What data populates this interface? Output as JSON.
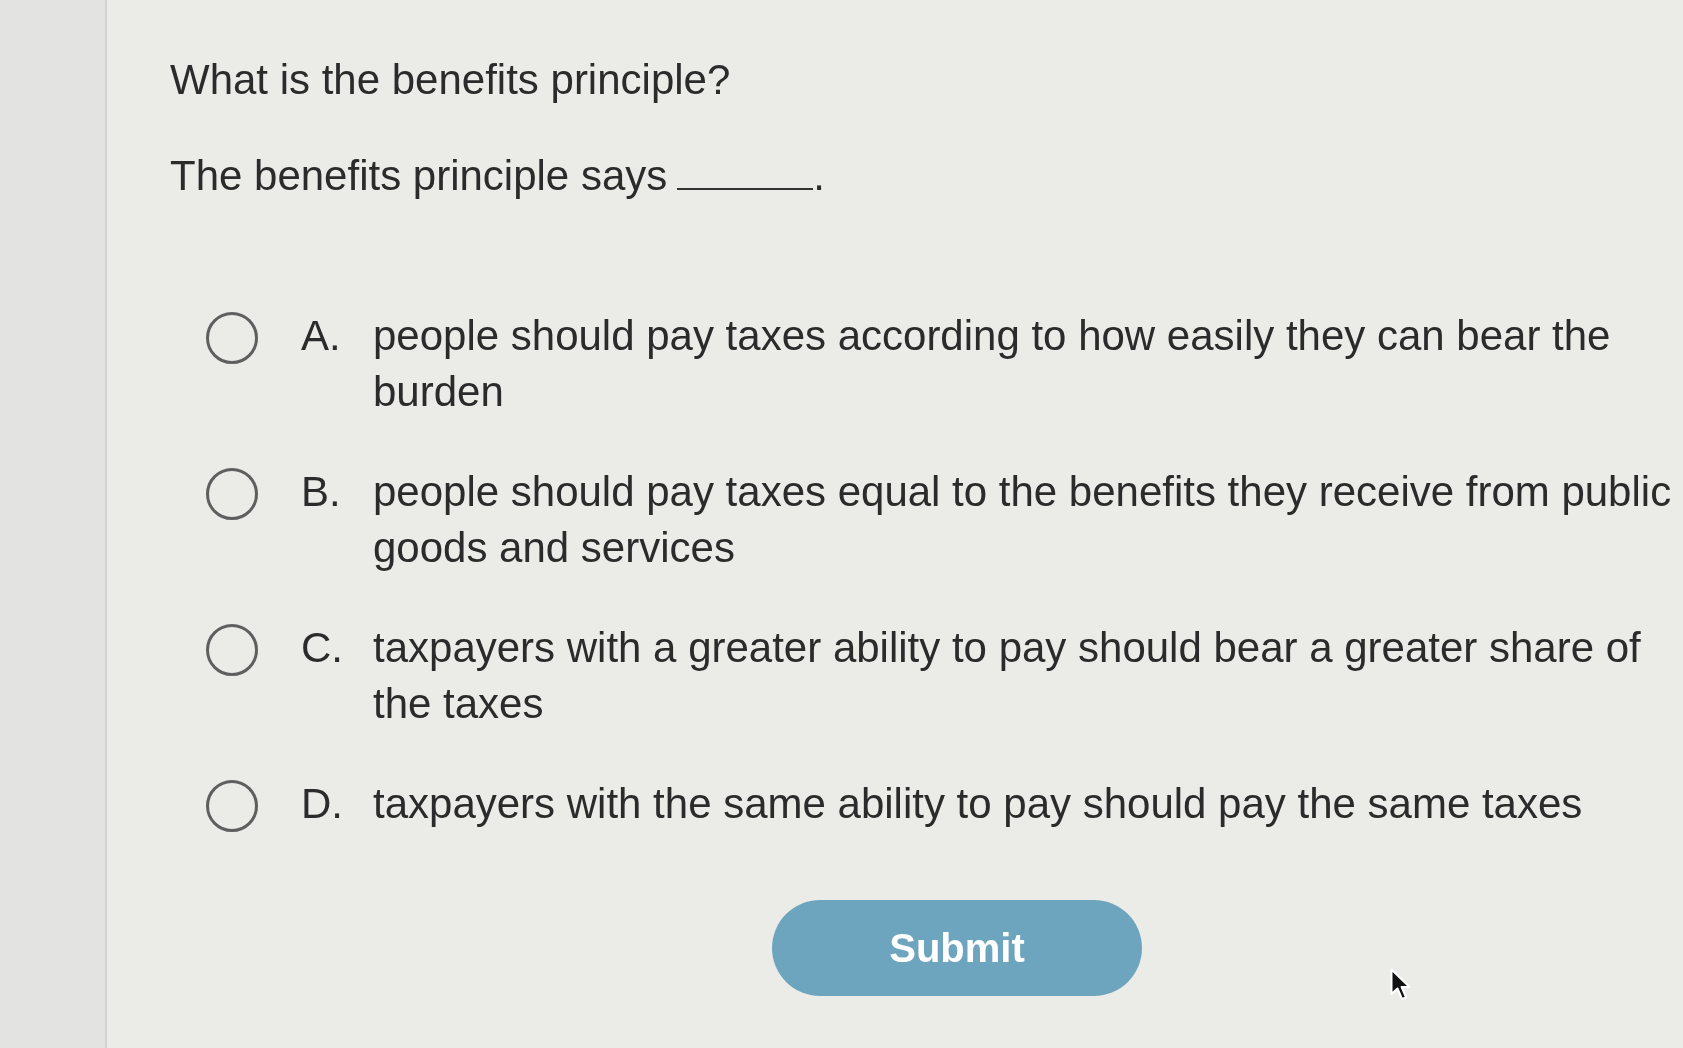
{
  "question": {
    "title": "What is the benefits principle?",
    "prompt": "The benefits principle says",
    "prompt_end": "."
  },
  "options": [
    {
      "letter": "A.",
      "text": "people should pay taxes according to how easily they can bear the burden",
      "selected": false
    },
    {
      "letter": "B.",
      "text": "people should pay taxes equal to the benefits they receive from public goods and services",
      "selected": false
    },
    {
      "letter": "C.",
      "text": "taxpayers with a greater ability to pay should bear a greater share of the taxes",
      "selected": false
    },
    {
      "letter": "D.",
      "text": "taxpayers with the same ability to pay should pay the same taxes",
      "selected": false
    }
  ],
  "submit_button": {
    "label": "Submit"
  }
}
